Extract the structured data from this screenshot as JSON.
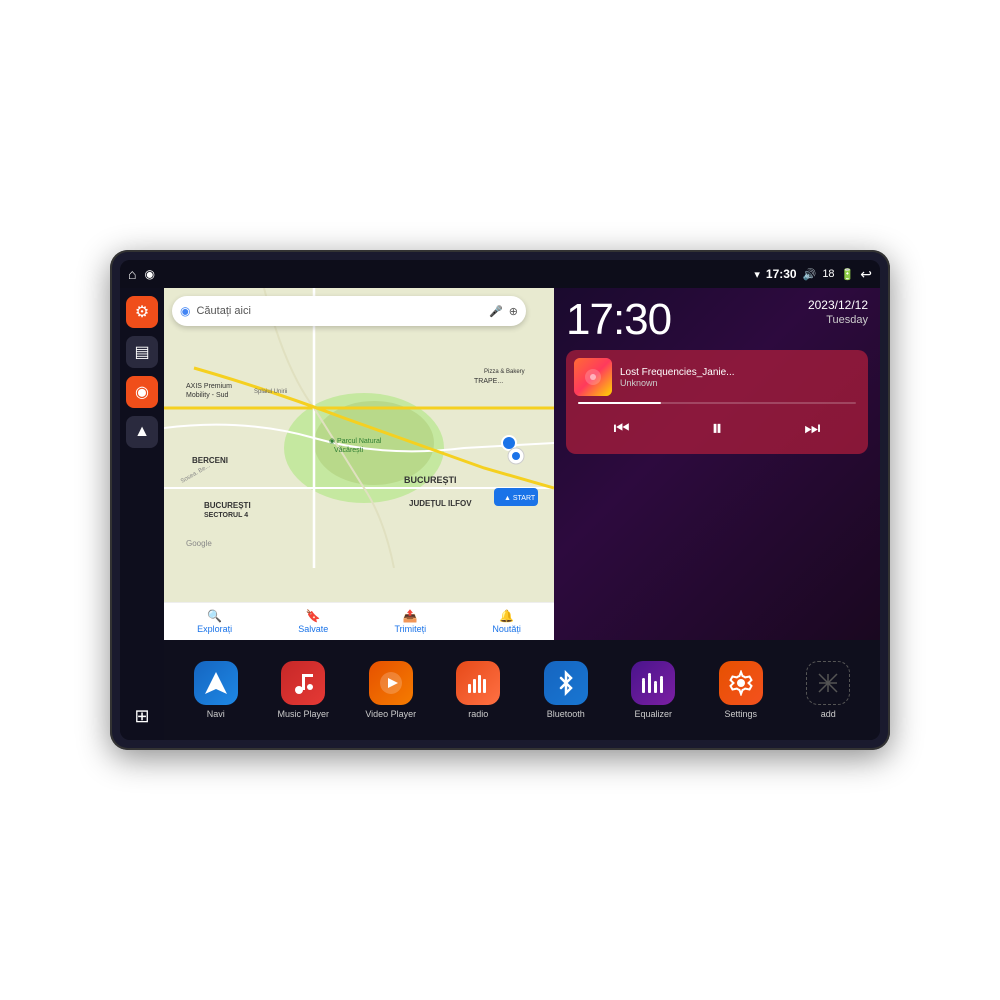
{
  "device": {
    "status_bar": {
      "wifi_icon": "▾",
      "time": "17:30",
      "volume_icon": "🔊",
      "battery_level": "18",
      "battery_icon": "🔋",
      "back_icon": "↩"
    },
    "sidebar": {
      "buttons": [
        {
          "id": "settings",
          "icon": "⚙",
          "color": "orange",
          "label": "Settings"
        },
        {
          "id": "files",
          "icon": "▤",
          "color": "dark",
          "label": "Files"
        },
        {
          "id": "maps",
          "icon": "◉",
          "color": "orange",
          "label": "Maps"
        },
        {
          "id": "navigation",
          "icon": "▲",
          "color": "dark",
          "label": "Navigation"
        },
        {
          "id": "grid",
          "icon": "⊞",
          "color": "grid",
          "label": "Grid"
        }
      ]
    },
    "map": {
      "search_placeholder": "Căutați aici",
      "location_label1": "AXIS Premium Mobility - Sud",
      "location_label2": "Pizza & Bakery",
      "location_label3": "Parcul Natural Văcărești",
      "location_label4": "BUCUREȘTI SECTORUL 4",
      "location_label5": "BUCUREȘTI",
      "location_label6": "JUDEȚUL ILFOV",
      "location_label7": "BERCENI",
      "nav_items": [
        {
          "icon": "🔍",
          "label": "Explorați"
        },
        {
          "icon": "🔖",
          "label": "Salvate"
        },
        {
          "icon": "📤",
          "label": "Trimiteți"
        },
        {
          "icon": "🔔",
          "label": "Noutăți"
        }
      ]
    },
    "clock": {
      "time": "17:30",
      "date": "2023/12/12",
      "day": "Tuesday"
    },
    "music": {
      "title": "Lost Frequencies_Janie...",
      "artist": "Unknown",
      "controls": {
        "prev": "⏮",
        "play": "⏸",
        "next": "⏭"
      }
    },
    "apps": [
      {
        "id": "navi",
        "icon": "▲",
        "label": "Navi",
        "style": "navi"
      },
      {
        "id": "music-player",
        "icon": "♪",
        "label": "Music Player",
        "style": "music"
      },
      {
        "id": "video-player",
        "icon": "▶",
        "label": "Video Player",
        "style": "video"
      },
      {
        "id": "radio",
        "icon": "📻",
        "label": "radio",
        "style": "radio"
      },
      {
        "id": "bluetooth",
        "icon": "₿",
        "label": "Bluetooth",
        "style": "bluetooth"
      },
      {
        "id": "equalizer",
        "icon": "≡",
        "label": "Equalizer",
        "style": "equalizer"
      },
      {
        "id": "settings",
        "icon": "⚙",
        "label": "Settings",
        "style": "settings"
      },
      {
        "id": "add",
        "icon": "+",
        "label": "add",
        "style": "add"
      }
    ]
  }
}
